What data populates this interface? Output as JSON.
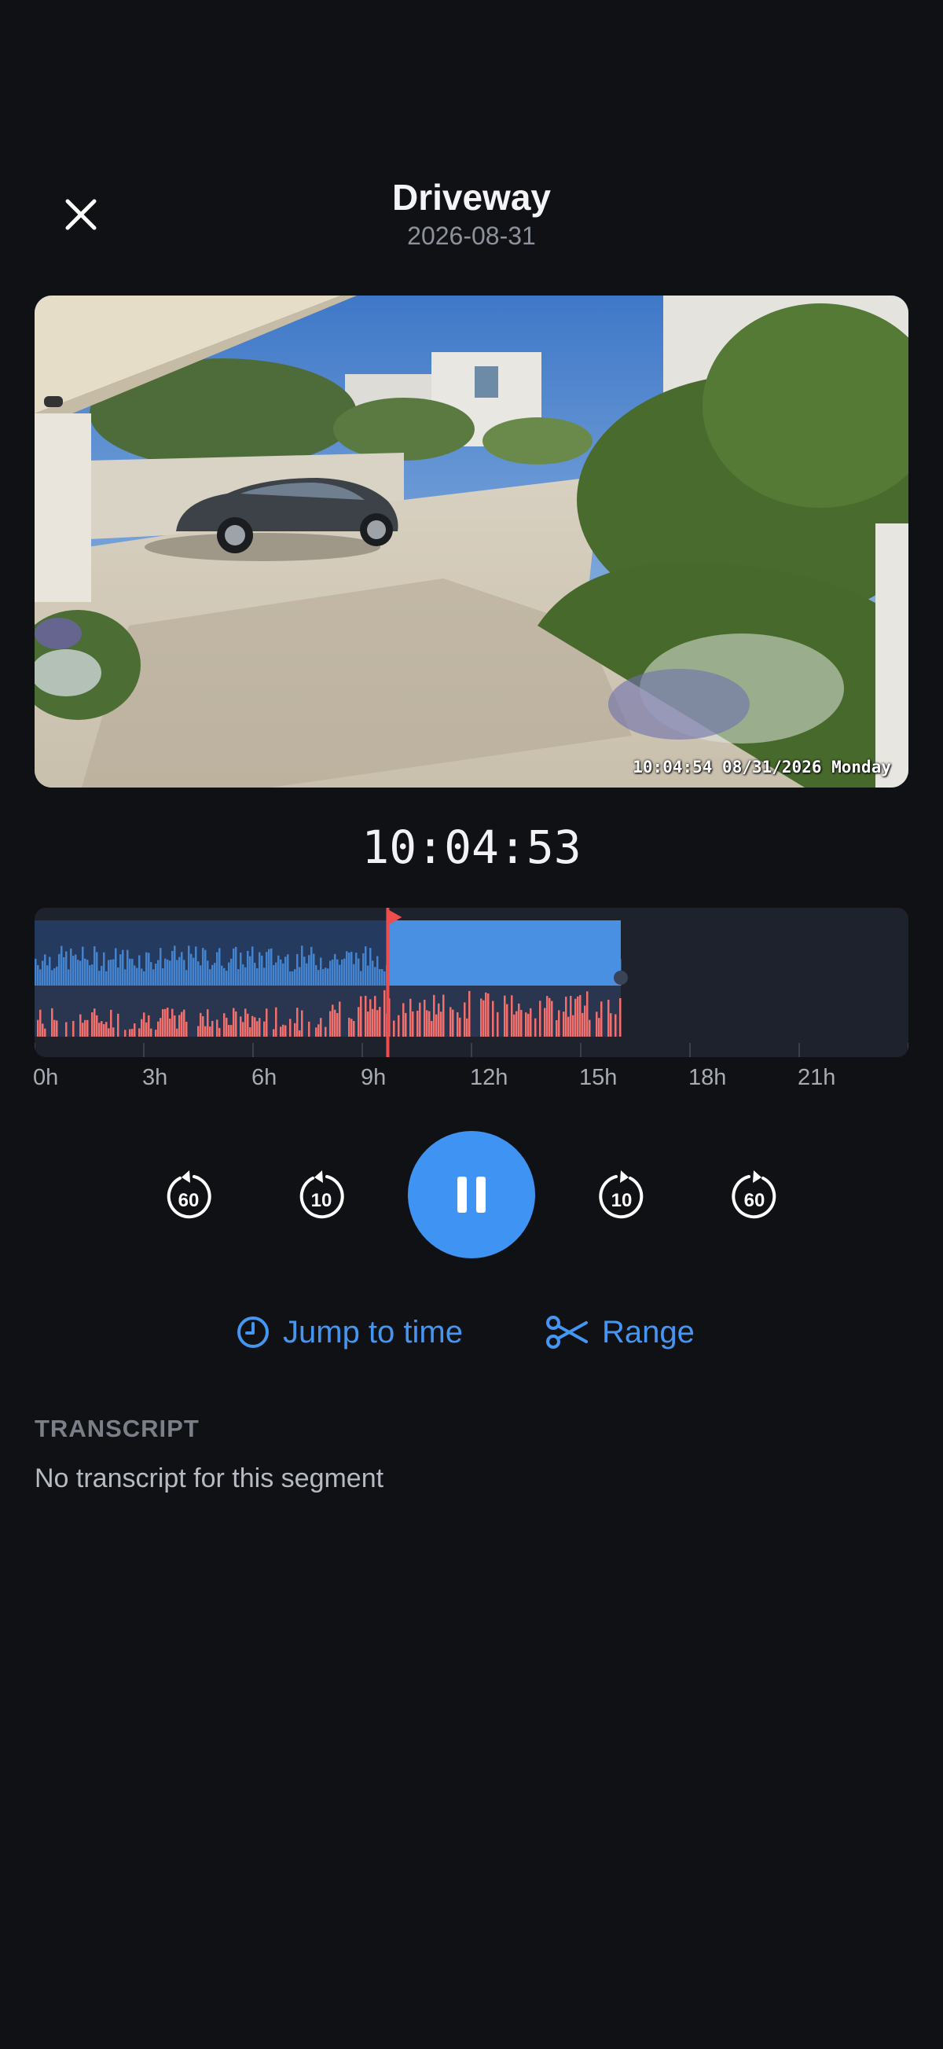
{
  "header": {
    "title": "Driveway",
    "date": "2026-08-31"
  },
  "video": {
    "overlay_timestamp": "10:04:54 08/31/2026 Monday",
    "scene": "driveway-camera-view-with-parked-car"
  },
  "playback": {
    "current_time": "10:04:53",
    "playhead_hour": 9.7,
    "recorded_until_hour": 16.1,
    "state": "playing"
  },
  "timeline": {
    "tick_labels": [
      "0h",
      "3h",
      "6h",
      "9h",
      "12h",
      "15h",
      "18h",
      "21h"
    ],
    "colors": {
      "motion_band": "#4a90e2",
      "audio_band": "#f2706b",
      "playhead": "#ee4d4d",
      "background": "#1d222c"
    }
  },
  "controls": {
    "rewind_60": "60",
    "rewind_10": "10",
    "forward_10": "10",
    "forward_60": "60",
    "play_pause_icon": "pause-icon"
  },
  "actions": {
    "jump_to_time": "Jump to time",
    "range": "Range"
  },
  "transcript": {
    "label": "TRANSCRIPT",
    "empty_text": "No transcript for this segment"
  },
  "accent_color": "#3f93f2"
}
